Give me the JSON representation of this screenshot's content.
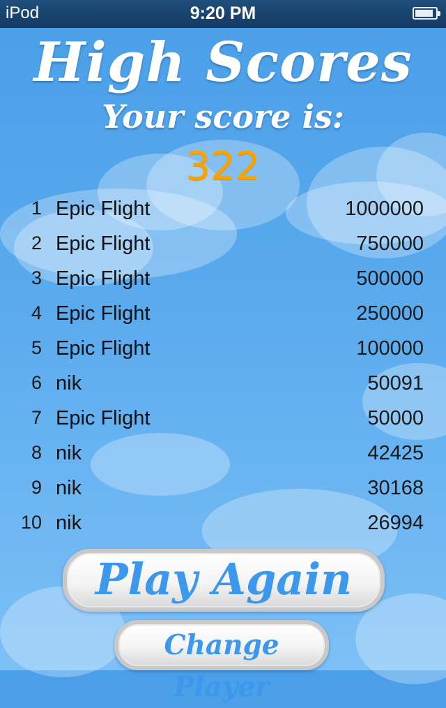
{
  "status_bar": {
    "carrier": "iPod",
    "time": "9:20 PM",
    "battery_level": 0.9
  },
  "header": {
    "title": "High Scores",
    "subtitle": "Your score is:",
    "score": "322"
  },
  "scores": [
    {
      "rank": "1",
      "name": "Epic Flight",
      "points": "1000000"
    },
    {
      "rank": "2",
      "name": "Epic Flight",
      "points": "750000"
    },
    {
      "rank": "3",
      "name": "Epic Flight",
      "points": "500000"
    },
    {
      "rank": "4",
      "name": "Epic Flight",
      "points": "250000"
    },
    {
      "rank": "5",
      "name": "Epic Flight",
      "points": "100000"
    },
    {
      "rank": "6",
      "name": "nik",
      "points": "50091"
    },
    {
      "rank": "7",
      "name": "Epic Flight",
      "points": "50000"
    },
    {
      "rank": "8",
      "name": "nik",
      "points": "42425"
    },
    {
      "rank": "9",
      "name": "nik",
      "points": "30168"
    },
    {
      "rank": "10",
      "name": "nik",
      "points": "26994"
    }
  ],
  "buttons": {
    "play_again": "Play Again",
    "change_player": "Change Player"
  },
  "colors": {
    "sky": "#5aaaee",
    "score_accent": "#f7a400",
    "button_text": "#3b98ec"
  }
}
